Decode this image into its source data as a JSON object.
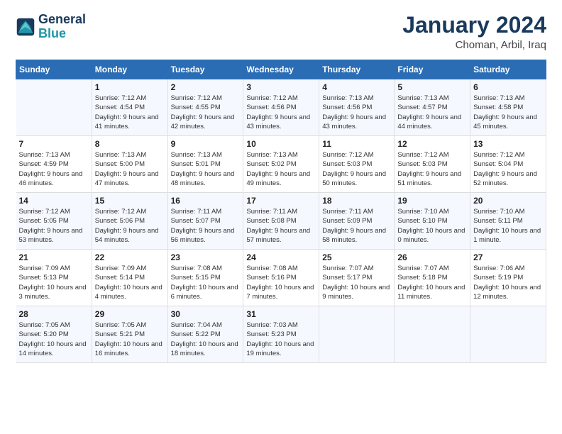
{
  "logo": {
    "line1": "General",
    "line2": "Blue"
  },
  "title": "January 2024",
  "subtitle": "Choman, Arbil, Iraq",
  "days_header": [
    "Sunday",
    "Monday",
    "Tuesday",
    "Wednesday",
    "Thursday",
    "Friday",
    "Saturday"
  ],
  "weeks": [
    [
      {
        "day": "",
        "sunrise": "",
        "sunset": "",
        "daylight": ""
      },
      {
        "day": "1",
        "sunrise": "Sunrise: 7:12 AM",
        "sunset": "Sunset: 4:54 PM",
        "daylight": "Daylight: 9 hours and 41 minutes."
      },
      {
        "day": "2",
        "sunrise": "Sunrise: 7:12 AM",
        "sunset": "Sunset: 4:55 PM",
        "daylight": "Daylight: 9 hours and 42 minutes."
      },
      {
        "day": "3",
        "sunrise": "Sunrise: 7:12 AM",
        "sunset": "Sunset: 4:56 PM",
        "daylight": "Daylight: 9 hours and 43 minutes."
      },
      {
        "day": "4",
        "sunrise": "Sunrise: 7:13 AM",
        "sunset": "Sunset: 4:56 PM",
        "daylight": "Daylight: 9 hours and 43 minutes."
      },
      {
        "day": "5",
        "sunrise": "Sunrise: 7:13 AM",
        "sunset": "Sunset: 4:57 PM",
        "daylight": "Daylight: 9 hours and 44 minutes."
      },
      {
        "day": "6",
        "sunrise": "Sunrise: 7:13 AM",
        "sunset": "Sunset: 4:58 PM",
        "daylight": "Daylight: 9 hours and 45 minutes."
      }
    ],
    [
      {
        "day": "7",
        "sunrise": "Sunrise: 7:13 AM",
        "sunset": "Sunset: 4:59 PM",
        "daylight": "Daylight: 9 hours and 46 minutes."
      },
      {
        "day": "8",
        "sunrise": "Sunrise: 7:13 AM",
        "sunset": "Sunset: 5:00 PM",
        "daylight": "Daylight: 9 hours and 47 minutes."
      },
      {
        "day": "9",
        "sunrise": "Sunrise: 7:13 AM",
        "sunset": "Sunset: 5:01 PM",
        "daylight": "Daylight: 9 hours and 48 minutes."
      },
      {
        "day": "10",
        "sunrise": "Sunrise: 7:13 AM",
        "sunset": "Sunset: 5:02 PM",
        "daylight": "Daylight: 9 hours and 49 minutes."
      },
      {
        "day": "11",
        "sunrise": "Sunrise: 7:12 AM",
        "sunset": "Sunset: 5:03 PM",
        "daylight": "Daylight: 9 hours and 50 minutes."
      },
      {
        "day": "12",
        "sunrise": "Sunrise: 7:12 AM",
        "sunset": "Sunset: 5:03 PM",
        "daylight": "Daylight: 9 hours and 51 minutes."
      },
      {
        "day": "13",
        "sunrise": "Sunrise: 7:12 AM",
        "sunset": "Sunset: 5:04 PM",
        "daylight": "Daylight: 9 hours and 52 minutes."
      }
    ],
    [
      {
        "day": "14",
        "sunrise": "Sunrise: 7:12 AM",
        "sunset": "Sunset: 5:05 PM",
        "daylight": "Daylight: 9 hours and 53 minutes."
      },
      {
        "day": "15",
        "sunrise": "Sunrise: 7:12 AM",
        "sunset": "Sunset: 5:06 PM",
        "daylight": "Daylight: 9 hours and 54 minutes."
      },
      {
        "day": "16",
        "sunrise": "Sunrise: 7:11 AM",
        "sunset": "Sunset: 5:07 PM",
        "daylight": "Daylight: 9 hours and 56 minutes."
      },
      {
        "day": "17",
        "sunrise": "Sunrise: 7:11 AM",
        "sunset": "Sunset: 5:08 PM",
        "daylight": "Daylight: 9 hours and 57 minutes."
      },
      {
        "day": "18",
        "sunrise": "Sunrise: 7:11 AM",
        "sunset": "Sunset: 5:09 PM",
        "daylight": "Daylight: 9 hours and 58 minutes."
      },
      {
        "day": "19",
        "sunrise": "Sunrise: 7:10 AM",
        "sunset": "Sunset: 5:10 PM",
        "daylight": "Daylight: 10 hours and 0 minutes."
      },
      {
        "day": "20",
        "sunrise": "Sunrise: 7:10 AM",
        "sunset": "Sunset: 5:11 PM",
        "daylight": "Daylight: 10 hours and 1 minute."
      }
    ],
    [
      {
        "day": "21",
        "sunrise": "Sunrise: 7:09 AM",
        "sunset": "Sunset: 5:13 PM",
        "daylight": "Daylight: 10 hours and 3 minutes."
      },
      {
        "day": "22",
        "sunrise": "Sunrise: 7:09 AM",
        "sunset": "Sunset: 5:14 PM",
        "daylight": "Daylight: 10 hours and 4 minutes."
      },
      {
        "day": "23",
        "sunrise": "Sunrise: 7:08 AM",
        "sunset": "Sunset: 5:15 PM",
        "daylight": "Daylight: 10 hours and 6 minutes."
      },
      {
        "day": "24",
        "sunrise": "Sunrise: 7:08 AM",
        "sunset": "Sunset: 5:16 PM",
        "daylight": "Daylight: 10 hours and 7 minutes."
      },
      {
        "day": "25",
        "sunrise": "Sunrise: 7:07 AM",
        "sunset": "Sunset: 5:17 PM",
        "daylight": "Daylight: 10 hours and 9 minutes."
      },
      {
        "day": "26",
        "sunrise": "Sunrise: 7:07 AM",
        "sunset": "Sunset: 5:18 PM",
        "daylight": "Daylight: 10 hours and 11 minutes."
      },
      {
        "day": "27",
        "sunrise": "Sunrise: 7:06 AM",
        "sunset": "Sunset: 5:19 PM",
        "daylight": "Daylight: 10 hours and 12 minutes."
      }
    ],
    [
      {
        "day": "28",
        "sunrise": "Sunrise: 7:05 AM",
        "sunset": "Sunset: 5:20 PM",
        "daylight": "Daylight: 10 hours and 14 minutes."
      },
      {
        "day": "29",
        "sunrise": "Sunrise: 7:05 AM",
        "sunset": "Sunset: 5:21 PM",
        "daylight": "Daylight: 10 hours and 16 minutes."
      },
      {
        "day": "30",
        "sunrise": "Sunrise: 7:04 AM",
        "sunset": "Sunset: 5:22 PM",
        "daylight": "Daylight: 10 hours and 18 minutes."
      },
      {
        "day": "31",
        "sunrise": "Sunrise: 7:03 AM",
        "sunset": "Sunset: 5:23 PM",
        "daylight": "Daylight: 10 hours and 19 minutes."
      },
      {
        "day": "",
        "sunrise": "",
        "sunset": "",
        "daylight": ""
      },
      {
        "day": "",
        "sunrise": "",
        "sunset": "",
        "daylight": ""
      },
      {
        "day": "",
        "sunrise": "",
        "sunset": "",
        "daylight": ""
      }
    ]
  ]
}
